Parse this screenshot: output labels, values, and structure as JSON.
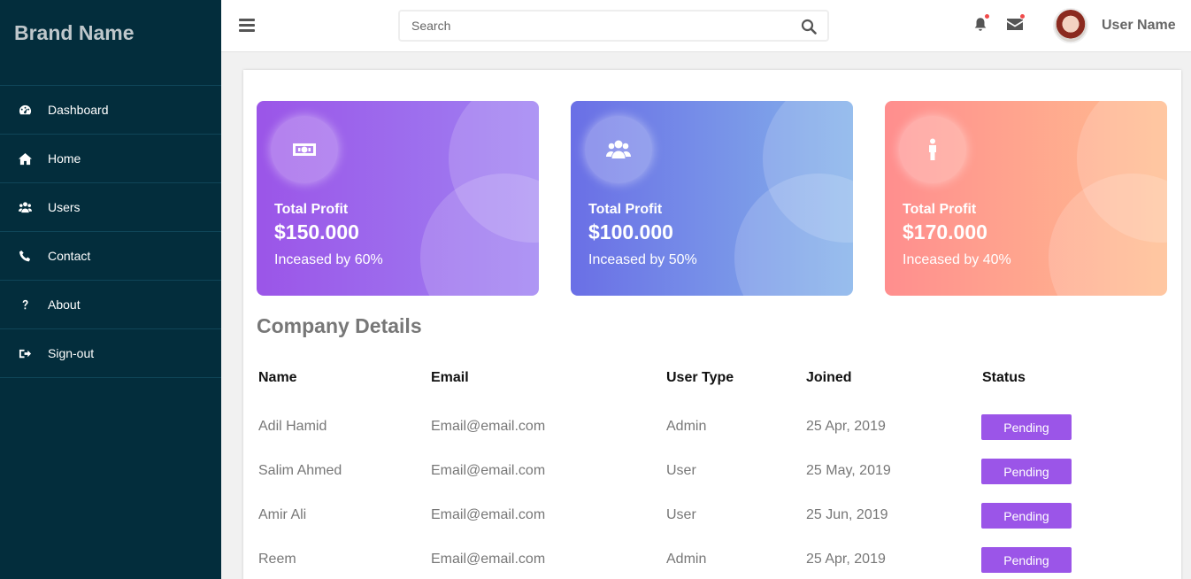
{
  "brand": "Brand Name",
  "sidebar": {
    "items": [
      {
        "label": "Dashboard",
        "icon": "dashboard-icon"
      },
      {
        "label": "Home",
        "icon": "home-icon"
      },
      {
        "label": "Users",
        "icon": "users-icon"
      },
      {
        "label": "Contact",
        "icon": "phone-icon"
      },
      {
        "label": "About",
        "icon": "question-icon"
      },
      {
        "label": "Sign-out",
        "icon": "sign-out-icon"
      }
    ]
  },
  "header": {
    "search_placeholder": "Search",
    "user_name": "User Name",
    "icons": [
      "menu-icon",
      "search-icon",
      "bell-icon",
      "envelope-icon"
    ]
  },
  "cards": [
    {
      "label": "Total Profit",
      "value": "$150.000",
      "sub": "Inceased by 60%",
      "icon": "money-icon"
    },
    {
      "label": "Total Profit",
      "value": "$100.000",
      "sub": "Inceased by 50%",
      "icon": "users-icon"
    },
    {
      "label": "Total Profit",
      "value": "$170.000",
      "sub": "Inceased by 40%",
      "icon": "person-icon"
    }
  ],
  "section_title": "Company Details",
  "table": {
    "headers": [
      "Name",
      "Email",
      "User Type",
      "Joined",
      "Status"
    ],
    "rows": [
      {
        "name": "Adil Hamid",
        "email": "Email@email.com",
        "type": "Admin",
        "joined": "25 Apr, 2019",
        "status": "Pending"
      },
      {
        "name": "Salim Ahmed",
        "email": "Email@email.com",
        "type": "User",
        "joined": "25 May, 2019",
        "status": "Pending"
      },
      {
        "name": "Amir Ali",
        "email": "Email@email.com",
        "type": "User",
        "joined": "25 Jun, 2019",
        "status": "Pending"
      },
      {
        "name": "Reem",
        "email": "Email@email.com",
        "type": "Admin",
        "joined": "25 Apr, 2019",
        "status": "Pending"
      }
    ]
  },
  "colors": {
    "sidebar_bg": "#032d3c",
    "status_bg": "#9b55e8",
    "card1": [
      "#9b55e8",
      "#9f82f2"
    ],
    "card2": [
      "#6a6fe6",
      "#84b2ea"
    ],
    "card3": [
      "#ff8e8e",
      "#ffbd8f"
    ]
  }
}
